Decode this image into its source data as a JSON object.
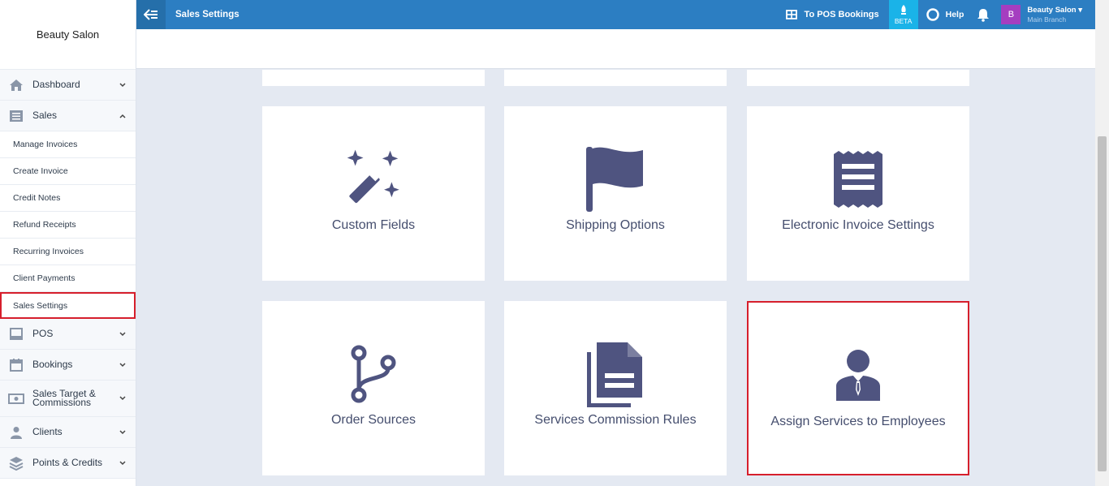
{
  "brand": "Beauty Salon",
  "topbar": {
    "title": "Sales Settings",
    "pos_link": "To POS Bookings",
    "beta": "BETA",
    "help": "Help",
    "account_name": "Beauty Salon",
    "account_branch": "Main Branch",
    "avatar_letter": "B"
  },
  "sidebar": {
    "items": [
      {
        "label": "Dashboard",
        "icon": "home-icon"
      },
      {
        "label": "Sales",
        "icon": "list-icon",
        "expanded": true
      },
      {
        "label": "POS",
        "icon": "monitor-icon"
      },
      {
        "label": "Bookings",
        "icon": "calendar-icon"
      },
      {
        "label": "Sales Target & Commissions",
        "icon": "money-icon"
      },
      {
        "label": "Clients",
        "icon": "user-icon"
      },
      {
        "label": "Points & Credits",
        "icon": "layers-icon"
      }
    ],
    "sales_sub": [
      "Manage Invoices",
      "Create Invoice",
      "Credit Notes",
      "Refund Receipts",
      "Recurring Invoices",
      "Client Payments",
      "Sales Settings"
    ],
    "active_sub": "Sales Settings"
  },
  "cards": [
    {
      "label": "Custom Fields",
      "icon": "magic-wand-icon"
    },
    {
      "label": "Shipping Options",
      "icon": "flag-icon"
    },
    {
      "label": "Electronic Invoice Settings",
      "icon": "receipt-icon"
    },
    {
      "label": "Order Sources",
      "icon": "branch-icon"
    },
    {
      "label": "Services Commission Rules",
      "icon": "documents-icon"
    },
    {
      "label": "Assign Services to Employees",
      "icon": "employee-icon",
      "highlighted": true
    }
  ],
  "colors": {
    "topbar": "#2c7ec2",
    "icon": "#4f5480",
    "highlight": "#d61f2c",
    "beta": "#1ab3e8",
    "avatar": "#a53ec0"
  }
}
